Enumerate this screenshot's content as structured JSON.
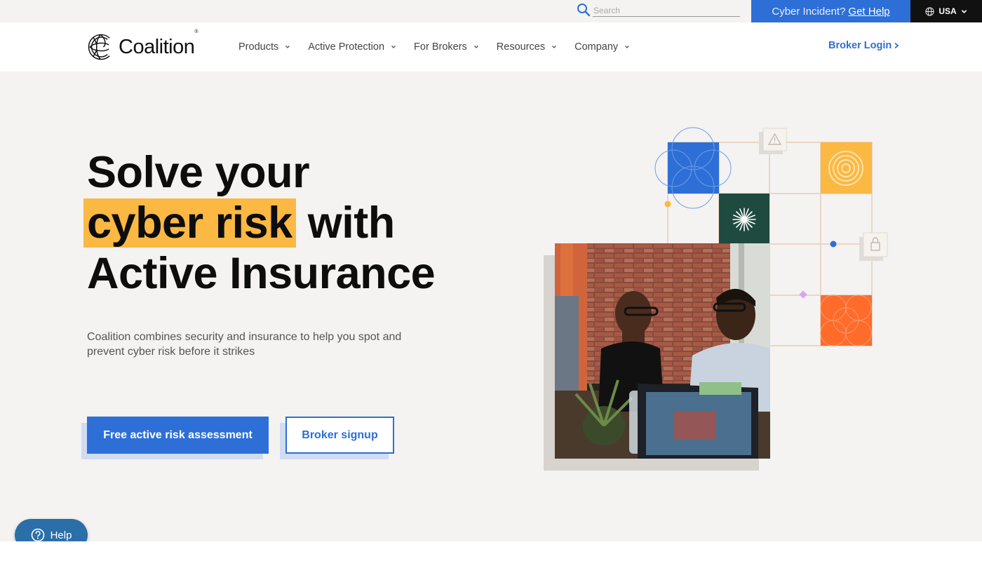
{
  "utility": {
    "search_placeholder": "Search",
    "incident_text": "Cyber Incident?",
    "incident_link": "Get Help",
    "region_label": "USA"
  },
  "nav": {
    "logo_text": "Coalition",
    "logo_reg": "®",
    "items": [
      {
        "label": "Products"
      },
      {
        "label": "Active Protection"
      },
      {
        "label": "For Brokers"
      },
      {
        "label": "Resources"
      },
      {
        "label": "Company"
      }
    ],
    "broker_login": "Broker Login"
  },
  "hero": {
    "title_line1": "Solve your",
    "title_highlight": "cyber risk",
    "title_line2_rest": " with",
    "title_line3": "Active Insurance",
    "subtitle": "Coalition combines security and insurance to help you spot and prevent cyber risk before it strikes",
    "cta_primary": "Free active risk assessment",
    "cta_secondary": "Broker signup"
  },
  "help": {
    "label": "Help"
  },
  "colors": {
    "brand_blue": "#2d6fd6",
    "highlight_yellow": "#fbb843",
    "tile_orange": "#ff6b2b",
    "tile_green": "#1f4a40",
    "help_blue": "#2b6fa8"
  }
}
